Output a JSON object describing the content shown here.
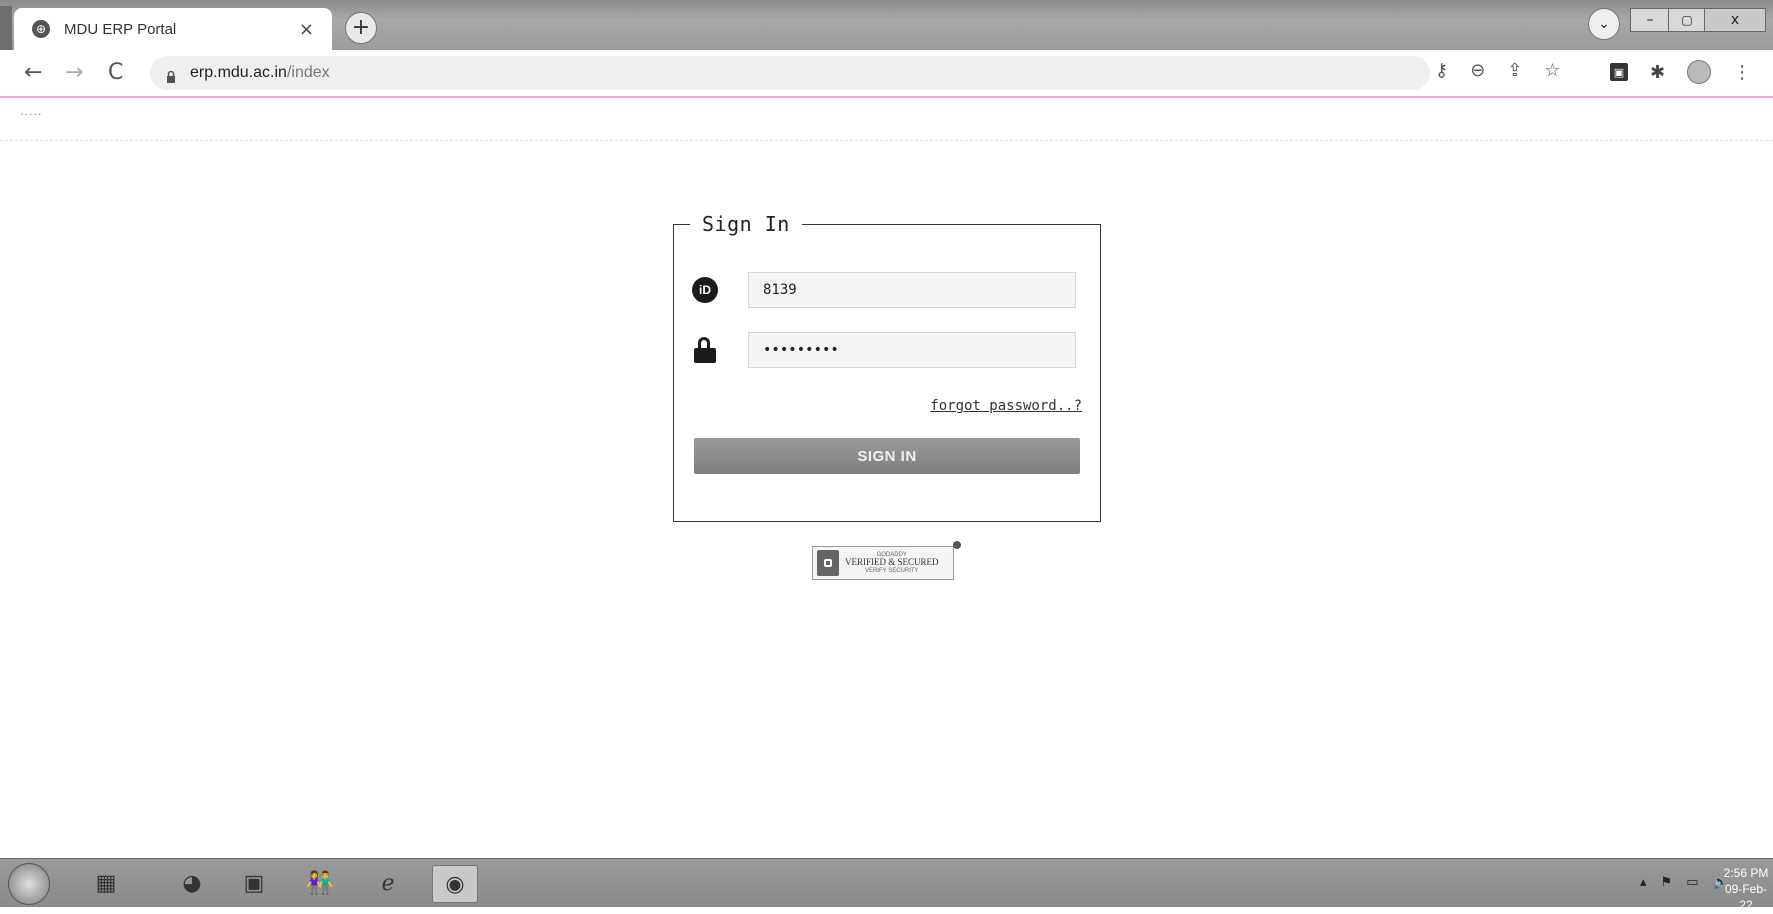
{
  "browser": {
    "tab_title": "MDU ERP Portal",
    "tab_close": "×",
    "new_tab": "+",
    "url_domain": "erp.mdu.ac.in",
    "url_path": "/index",
    "nav_back": "←",
    "nav_forward": "→",
    "nav_reload": "C",
    "omnibox_icons": [
      "key-icon",
      "zoom-out-icon",
      "share-icon",
      "star-icon"
    ],
    "extension_icons": [
      "pdf-extension-icon",
      "puzzle-extensions-icon",
      "profile-avatar",
      "kebab-menu-icon"
    ],
    "window_controls": {
      "menu": "⌄",
      "minimize": "–",
      "maximize": "▢",
      "close": "x"
    }
  },
  "page": {
    "top_dots": "·····",
    "signin": {
      "legend": "Sign In",
      "user_icon": "iD",
      "username_value": "8139",
      "password_value": "•••••••••",
      "forgot_link": "forgot password..?",
      "button_label": "SIGN IN"
    },
    "badge": {
      "top_line": "GODADDY",
      "main_line": "VERIFIED & SECURED",
      "bottom_line": "VERIFY SECURITY"
    }
  },
  "taskbar": {
    "items": [
      "file-explorer-icon",
      "edge-icon",
      "media-player-icon",
      "people-icon",
      "internet-explorer-icon",
      "chrome-icon"
    ],
    "tray_icons": [
      "show-hidden-icon",
      "flag-icon",
      "network-icon",
      "volume-icon"
    ],
    "time": "2:56 PM",
    "date": "09-Feb-22"
  },
  "colors": {
    "accent_line": "#f4a6d6",
    "button_bg": "#8a8a8a",
    "input_bg": "#f5f5f7"
  }
}
